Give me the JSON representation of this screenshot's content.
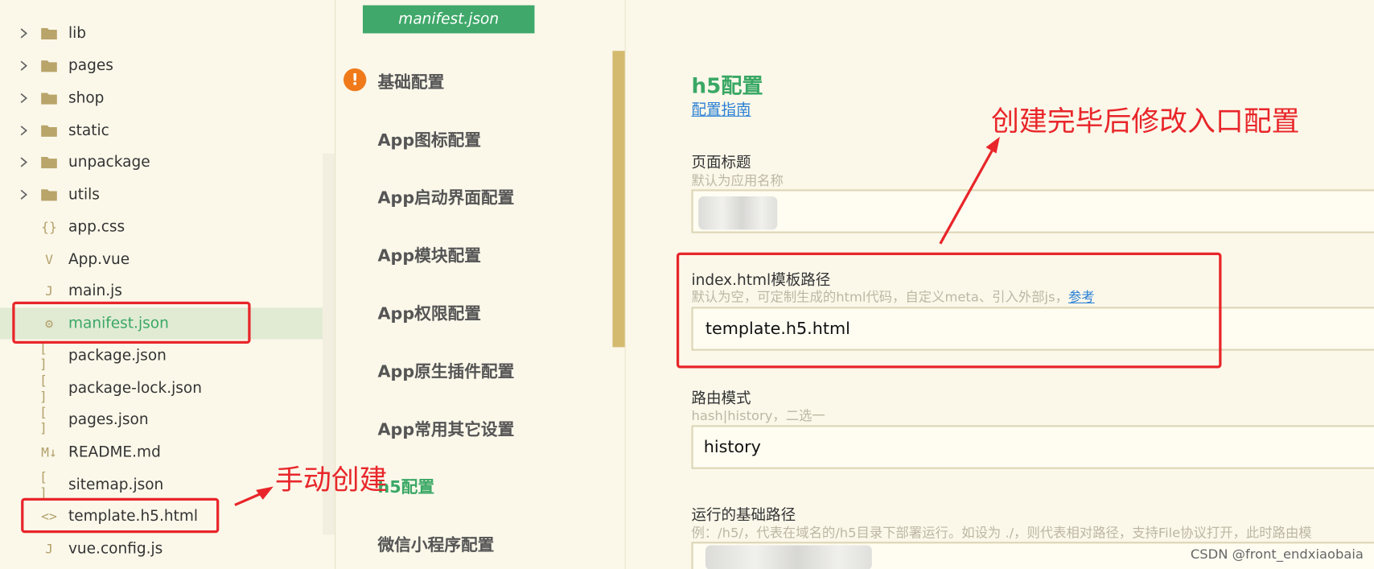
{
  "explorer": {
    "items": [
      {
        "label": "lib",
        "icon": "folder-icon",
        "expandable": true
      },
      {
        "label": "pages",
        "icon": "folder-icon",
        "expandable": true
      },
      {
        "label": "shop",
        "icon": "folder-icon",
        "expandable": true
      },
      {
        "label": "static",
        "icon": "folder-icon",
        "expandable": true
      },
      {
        "label": "unpackage",
        "icon": "folder-icon",
        "expandable": true
      },
      {
        "label": "utils",
        "icon": "folder-icon",
        "expandable": true
      },
      {
        "label": "app.css",
        "icon": "css-file-icon",
        "glyph": "{}"
      },
      {
        "label": "App.vue",
        "icon": "vue-file-icon",
        "glyph": "V"
      },
      {
        "label": "main.js",
        "icon": "js-file-icon",
        "glyph": "J"
      },
      {
        "label": "manifest.json",
        "icon": "manifest-file-icon",
        "glyph": "⚙",
        "selected": true
      },
      {
        "label": "package.json",
        "icon": "json-file-icon",
        "glyph": "[ ]"
      },
      {
        "label": "package-lock.json",
        "icon": "json-file-icon",
        "glyph": "[ ]"
      },
      {
        "label": "pages.json",
        "icon": "json-file-icon",
        "glyph": "[ ]"
      },
      {
        "label": "README.md",
        "icon": "markdown-file-icon",
        "glyph": "M↓"
      },
      {
        "label": "sitemap.json",
        "icon": "json-file-icon",
        "glyph": "[ ]"
      },
      {
        "label": "template.h5.html",
        "icon": "html-file-icon",
        "glyph": "<>"
      },
      {
        "label": "vue.config.js",
        "icon": "js-file-icon",
        "glyph": "J"
      }
    ]
  },
  "editor_tab": {
    "label": "manifest.json"
  },
  "config_nav": {
    "items": [
      {
        "label": "基础配置",
        "warning": true
      },
      {
        "label": "App图标配置"
      },
      {
        "label": "App启动界面配置"
      },
      {
        "label": "App模块配置"
      },
      {
        "label": "App权限配置"
      },
      {
        "label": "App原生插件配置"
      },
      {
        "label": "App常用其它设置"
      },
      {
        "label": "h5配置",
        "active": true
      },
      {
        "label": "微信小程序配置"
      }
    ]
  },
  "form": {
    "title": "h5配置",
    "guide_link": "配置指南",
    "fields": {
      "page_title": {
        "label": "页面标题",
        "hint": "默认为应用名称",
        "value": ""
      },
      "template": {
        "label": "index.html模板路径",
        "hint": "默认为空，可定制生成的html代码，自定义meta、引入外部js，",
        "hint_link": "参考",
        "value": "template.h5.html"
      },
      "router_mode": {
        "label": "路由模式",
        "hint": "hash|history，二选一",
        "value": "history"
      },
      "base_path": {
        "label": "运行的基础路径",
        "hint": "例：/h5/，代表在域名的/h5目录下部署运行。如设为 ./，则代表相对路径，支持File协议打开，此时路由模",
        "value": ""
      }
    }
  },
  "annotations": {
    "manual_create": "手动创建",
    "modify_entry": "创建完毕后修改入口配置",
    "color": "#e8262a"
  },
  "watermark": "CSDN @front_endxiaobaia",
  "colors": {
    "accent_green": "#3aa865",
    "tab_green": "#3fa86a",
    "link_blue": "#2a7fd4",
    "warning_orange": "#f07a1a",
    "background": "#fbf8ea"
  }
}
